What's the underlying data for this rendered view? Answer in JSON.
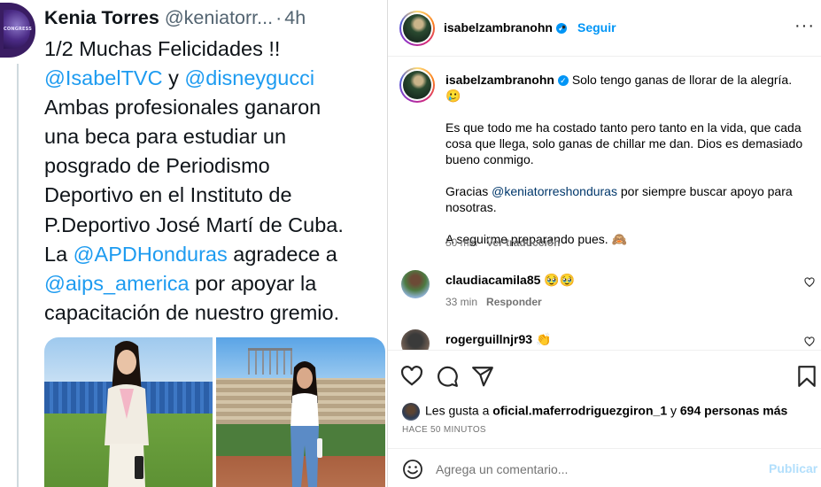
{
  "tweet": {
    "author_name": "Kenia Torres",
    "author_handle": "@keniatorr...",
    "separator": "·",
    "time": "4h",
    "avatar_text": "CONGRESS",
    "lines": [
      [
        {
          "t": "1/2 Muchas Felicidades !!",
          "m": false
        }
      ],
      [
        {
          "t": "@IsabelTVC",
          "m": true
        },
        {
          "t": " y ",
          "m": false
        },
        {
          "t": "@disneygucci",
          "m": true
        }
      ],
      [
        {
          "t": "Ambas profesionales ganaron",
          "m": false
        }
      ],
      [
        {
          "t": "una beca  para estudiar un",
          "m": false
        }
      ],
      [
        {
          "t": "posgrado de Periodismo",
          "m": false
        }
      ],
      [
        {
          "t": "Deportivo en el Instituto de",
          "m": false
        }
      ],
      [
        {
          "t": "P.Deportivo José Martí de Cuba.",
          "m": false
        }
      ],
      [
        {
          "t": "La ",
          "m": false
        },
        {
          "t": "@APDHonduras",
          "m": true
        },
        {
          "t": " agradece a",
          "m": false
        }
      ],
      [
        {
          "t": "@aips_america",
          "m": true
        },
        {
          "t": " por apoyar la",
          "m": false
        }
      ],
      [
        {
          "t": "capacitación de nuestro gremio.",
          "m": false
        }
      ]
    ]
  },
  "instagram": {
    "header": {
      "username": "isabelzambranohn",
      "dot": "•",
      "follow_label": "Seguir",
      "more_label": "···"
    },
    "caption": {
      "username": "isabelzambranohn",
      "first_line": "Solo tengo ganas de llorar de la alegría. 🥲",
      "paragraph_2": "Es que todo me ha costado tanto pero tanto en la vida, que cada cosa que llega, solo ganas de chillar me dan. Dios es demasiado bueno conmigo.",
      "p3_before": "Gracias ",
      "p3_mention": "@keniatorreshonduras",
      "p3_after": " por siempre buscar apoyo para nosotras.",
      "paragraph_4": "A seguirme preparando pues. 🙈",
      "time": "50 min",
      "translate_label": "Ver traducción"
    },
    "comments": [
      {
        "username": "claudiacamila85",
        "text": "🥹🥹",
        "time": "33 min",
        "reply_label": "Responder"
      },
      {
        "username": "rogerguillnjr93",
        "text": "👏"
      }
    ],
    "likes": {
      "prefix": "Les gusta a ",
      "user": "oficial.maferrodriguezgiron_1",
      "middle": " y ",
      "others": "694 personas más"
    },
    "time_ago": "HACE 50 MINUTOS",
    "add_comment": {
      "placeholder": "Agrega un comentario...",
      "post_label": "Publicar"
    },
    "colors": {
      "link": "#0095f6",
      "mention": "#00376b",
      "tweet_mention": "#1d9bf0",
      "post_disabled": "#b2dffc"
    },
    "icons": [
      "heart-icon",
      "comment-icon",
      "share-icon",
      "bookmark-icon",
      "emoji-icon",
      "verified-badge-icon",
      "more-options-icon"
    ]
  }
}
